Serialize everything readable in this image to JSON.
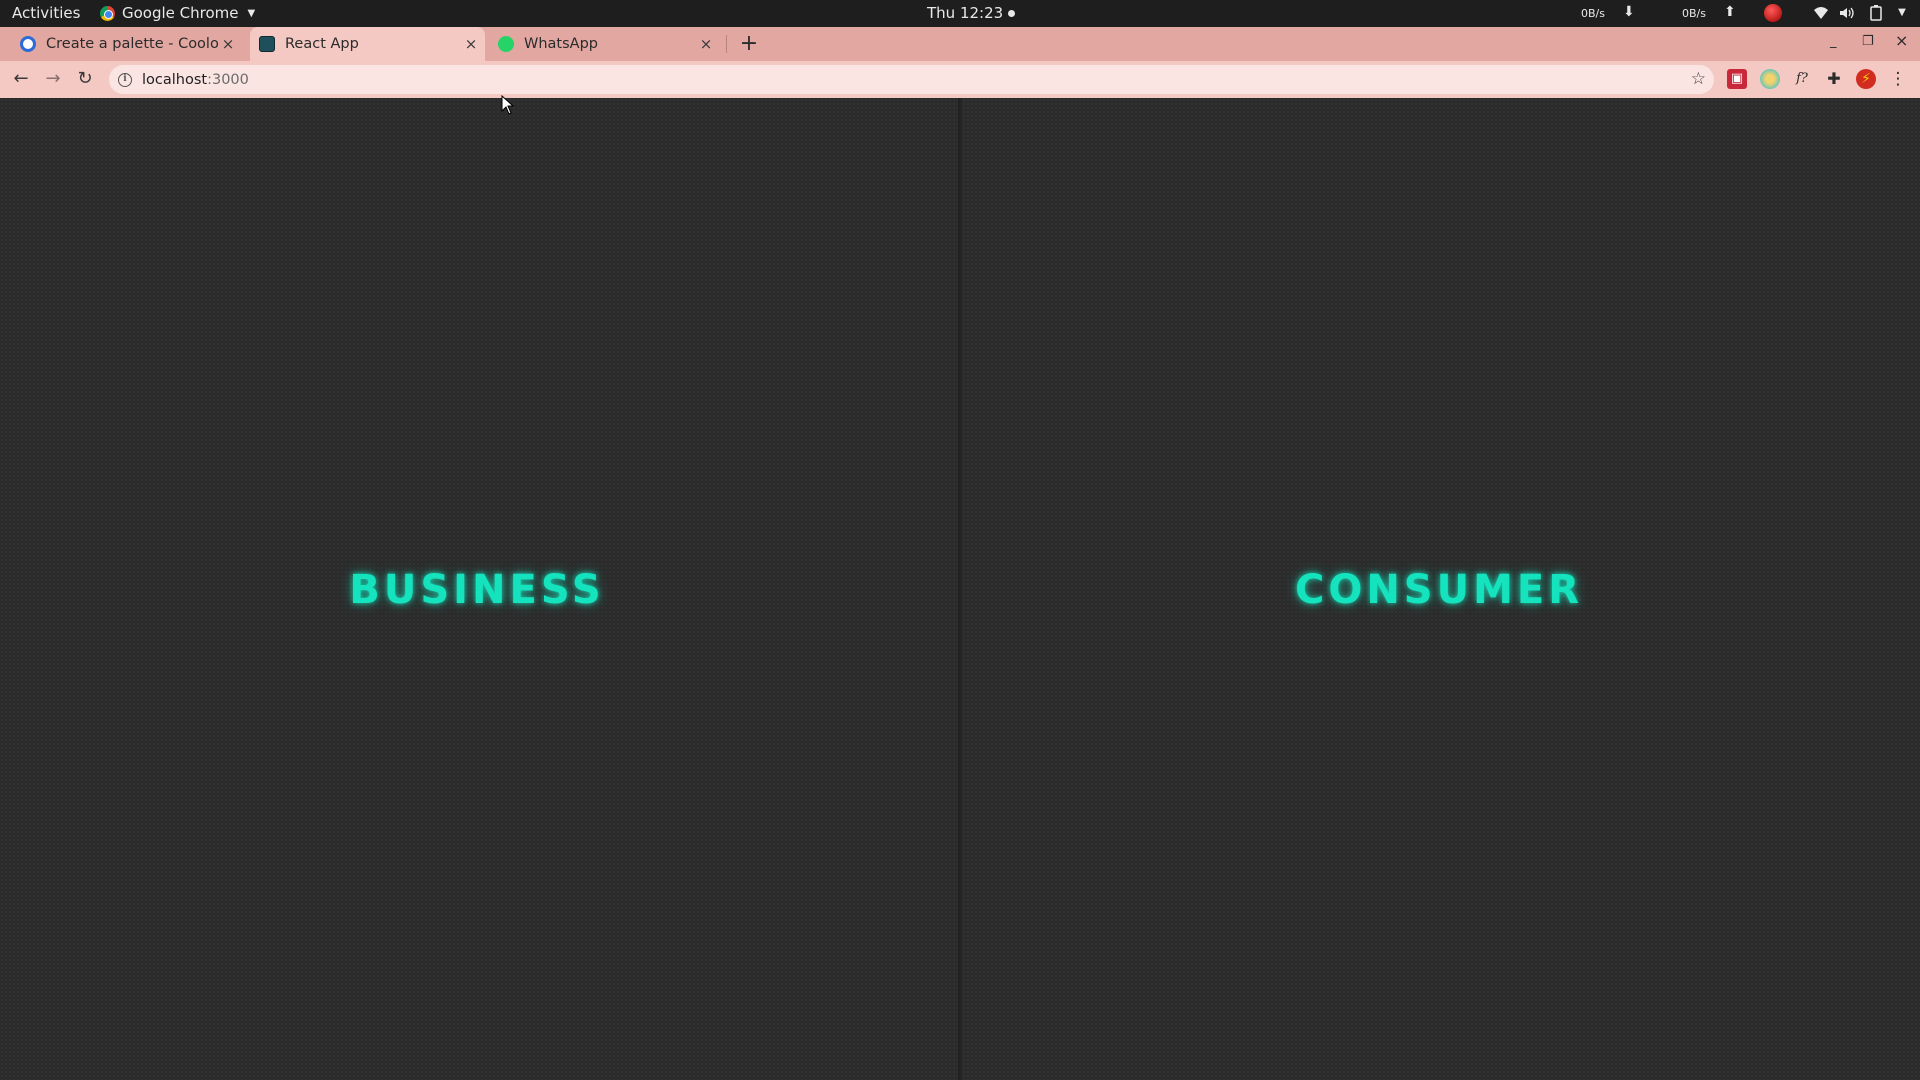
{
  "topbar": {
    "activities": "Activities",
    "app_name": "Google Chrome",
    "clock": "Thu 12:23",
    "net_down": "0B/s",
    "net_up": "0B/s"
  },
  "tabs": [
    {
      "label": "Create a palette - Coolors",
      "close": "×"
    },
    {
      "label": "React App",
      "close": "×"
    },
    {
      "label": "WhatsApp",
      "close": "×"
    }
  ],
  "newtab": "+",
  "toolbar": {
    "back": "←",
    "forward": "→",
    "reload": "↻",
    "url_host": "localhost",
    "url_port": ":3000",
    "star": "☆",
    "menu": "⋮"
  },
  "window_controls": {
    "minimize": "_",
    "maximize": "❐",
    "close": "×"
  },
  "page": {
    "left_label": "BUSINESS",
    "right_label": "CONSUMER"
  },
  "colors": {
    "accent": "#14e3bd",
    "panel_bg": "#2b2b2b",
    "tabstrip": "#e3a7a2",
    "toolbar": "#f4c9c4"
  },
  "icons": {
    "coolors_favicon": "coolors-icon",
    "react_favicon": "react-app-icon",
    "whatsapp_favicon": "whatsapp-icon"
  }
}
